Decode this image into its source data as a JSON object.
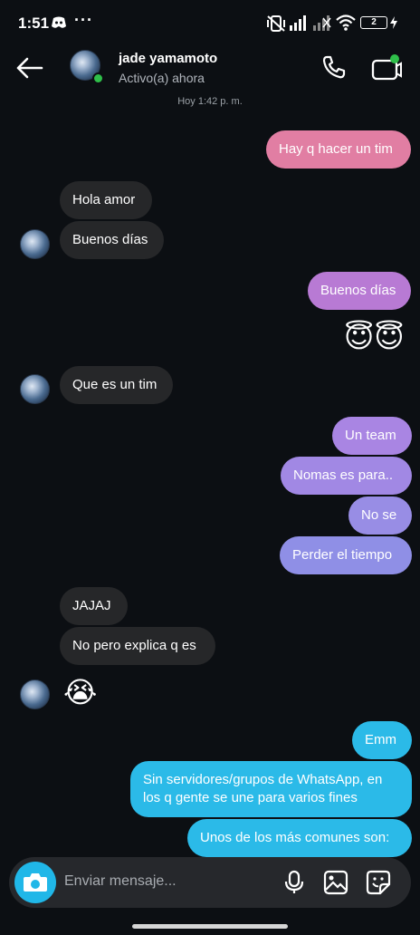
{
  "status_bar": {
    "time": "1:51",
    "dots": "···",
    "battery": "2"
  },
  "header": {
    "name": "jade yamamoto",
    "status": "Activo(a) ahora",
    "timestamp": "Hoy 1:42 p. m."
  },
  "messages": [
    {
      "side": "out",
      "text": "Hay q hacer un tim",
      "color": "#e17ea3"
    },
    {
      "side": "in",
      "text": "Hola amor"
    },
    {
      "side": "in",
      "text": "Buenos días"
    },
    {
      "side": "out",
      "text": "Buenos días",
      "color": "#b87ad4"
    },
    {
      "side": "out",
      "text": "😇😇",
      "kind": "emoji"
    },
    {
      "side": "in",
      "text": "Que es un tim"
    },
    {
      "side": "out",
      "text": "Un team",
      "color": "#a985e3"
    },
    {
      "side": "out",
      "text": "Nomas es para..",
      "color": "#a188e4"
    },
    {
      "side": "out",
      "text": "No se",
      "color": "#988de5"
    },
    {
      "side": "out",
      "text": "Perder el tiempo",
      "color": "#8f8fe6"
    },
    {
      "side": "in",
      "text": "JAJAJ"
    },
    {
      "side": "in",
      "text": "No pero explica q es"
    },
    {
      "side": "in",
      "text": "😭",
      "kind": "emoji"
    },
    {
      "side": "out",
      "text": "Emm",
      "color": "#2bbae8"
    },
    {
      "side": "out",
      "text": "Sin servidores/grupos de WhatsApp, en los q gente se une para varios fines",
      "color": "#2bbae8"
    },
    {
      "side": "out",
      "text": "Unos de los más comunes son:",
      "color": "#2bbae8"
    }
  ],
  "composer": {
    "placeholder": "Enviar mensaje..."
  },
  "colors": {
    "background": "#0c0f13",
    "incoming": "#262729",
    "accent": "#20b7e8",
    "online": "#2fbf4a"
  }
}
